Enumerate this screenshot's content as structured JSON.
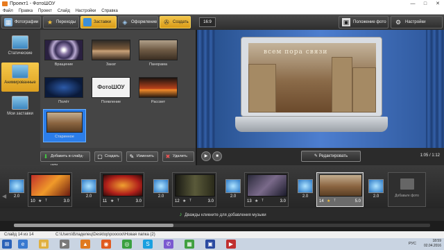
{
  "window": {
    "title": "Проект1 - ФотоШОУ",
    "controls": [
      "—",
      "□",
      "✕"
    ]
  },
  "menu": [
    "Файл",
    "Правка",
    "Проект",
    "Слайд",
    "Настройки",
    "Справка"
  ],
  "toolbar": {
    "tabs": [
      {
        "label": "Фотографии",
        "icon": "photos-icon"
      },
      {
        "label": "Переходы",
        "icon": "star-icon"
      },
      {
        "label": "Заставки",
        "icon": "screensaver-icon",
        "active": true
      },
      {
        "label": "Оформление",
        "icon": "design-icon"
      },
      {
        "label": "Создать",
        "icon": "film-reel-icon"
      }
    ],
    "ratio": "16:9",
    "photo_position": "Положение фото",
    "photo_settings": "Настройки проекта"
  },
  "categories": [
    {
      "label": "Статические"
    },
    {
      "label": "Анимированные",
      "active": true
    },
    {
      "label": "Мои заставки"
    }
  ],
  "intros": [
    {
      "label": "Вращение"
    },
    {
      "label": "Закат"
    },
    {
      "label": "Панорама"
    },
    {
      "label": "Полёт"
    },
    {
      "label": "Появление",
      "logo": "ФотоШОУ"
    },
    {
      "label": "Рассвет"
    },
    {
      "label": "Старинное",
      "selected": true
    }
  ],
  "actions": {
    "add": "Добавить в слайд-шоу",
    "create": "Создать",
    "edit": "Изменить",
    "delete": "Удалить"
  },
  "preview": {
    "photo_text": "всем пора связи",
    "edit_button": "Редактировать",
    "timecode": "1:05 / 1:12"
  },
  "timeline": {
    "slides": [
      {
        "num": "10",
        "dur": "3.0",
        "selected": false
      },
      {
        "num": "11",
        "dur": "3.0",
        "selected": false
      },
      {
        "num": "12",
        "dur": "3.0",
        "selected": false
      },
      {
        "num": "13",
        "dur": "3.0",
        "selected": false
      },
      {
        "num": "14",
        "dur": "5.0",
        "selected": true
      }
    ],
    "transitions": [
      "2.0",
      "2.0",
      "2.0",
      "2.0",
      "2.0",
      "2.0"
    ],
    "add_photo": "Добавьте фото",
    "music_hint": "Дважды кликните для добавления музыки"
  },
  "status": {
    "slide": "Слайд 14 из 14",
    "path": "C:\\Users\\Владелец\\Desktop\\рооооо\\Новая папка (2)"
  },
  "taskbar": {
    "lang": "РУС",
    "time": "18:59",
    "date": "02.04.2016"
  }
}
